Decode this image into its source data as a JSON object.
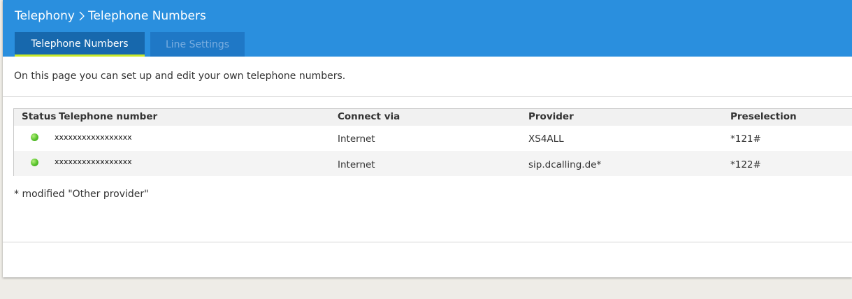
{
  "breadcrumb": {
    "parent": "Telephony",
    "current": "Telephone Numbers"
  },
  "tabs": [
    {
      "label": "Telephone Numbers",
      "active": true
    },
    {
      "label": "Line Settings",
      "active": false
    }
  ],
  "intro_text": "On this page you can set up and edit your own telephone numbers.",
  "table": {
    "columns": {
      "status": "Status",
      "number": "Telephone number",
      "connect": "Connect via",
      "provider": "Provider",
      "preselection": "Preselection"
    },
    "rows": [
      {
        "status": "green-status-icon",
        "number": "xxxxxxxxxxxxxxxxx",
        "connect": "Internet",
        "provider": "XS4ALL",
        "preselection": "*121#"
      },
      {
        "status": "green-status-icon",
        "number": "xxxxxxxxxxxxxxxxx",
        "connect": "Internet",
        "provider": "sip.dcalling.de*",
        "preselection": "*122#"
      }
    ]
  },
  "footnote": "* modified \"Other provider\"",
  "colors": {
    "header": "#2a8fde",
    "active_tab": "#1768ad",
    "active_tab_underline": "#c9e82a",
    "inactive_tab": "#1f78c6",
    "status_ok": "#56c22a"
  }
}
